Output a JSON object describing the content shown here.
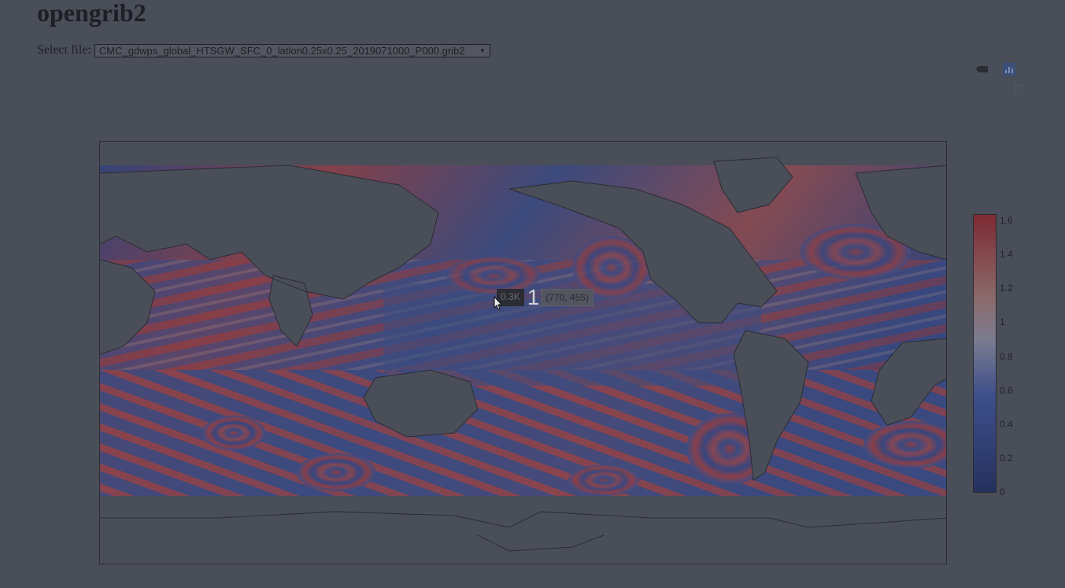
{
  "page": {
    "title": "opengrib2"
  },
  "file_selector": {
    "label": "Select file:",
    "selected": "CMC_gdwps_global_HTSGW_SFC_0_latlon0.25x0.25_2019071000_P000.grib2"
  },
  "modebar": {
    "tools": [
      {
        "name": "toggle-hover-icon"
      },
      {
        "name": "plotly-logo-icon"
      },
      {
        "name": "pan-icon"
      }
    ]
  },
  "hover": {
    "value_label": "0.3K",
    "big_label": "1",
    "coord_label": "(770, 455)"
  },
  "colors": {
    "background": "#4a4e58",
    "colorscale_low": "#2c3a6b",
    "colorscale_mid": "#7c7a8a",
    "colorscale_high": "#8e3a3f",
    "land": "#4a4e58",
    "coast": "#2b2d33"
  },
  "chart_data": {
    "type": "heatmap",
    "title": "",
    "colorbar": {
      "ticks": [
        "0",
        "0.2",
        "0.4",
        "0.6",
        "0.8",
        "1",
        "1.2",
        "1.4",
        "1.6"
      ],
      "range": [
        0,
        1.6
      ]
    }
  }
}
